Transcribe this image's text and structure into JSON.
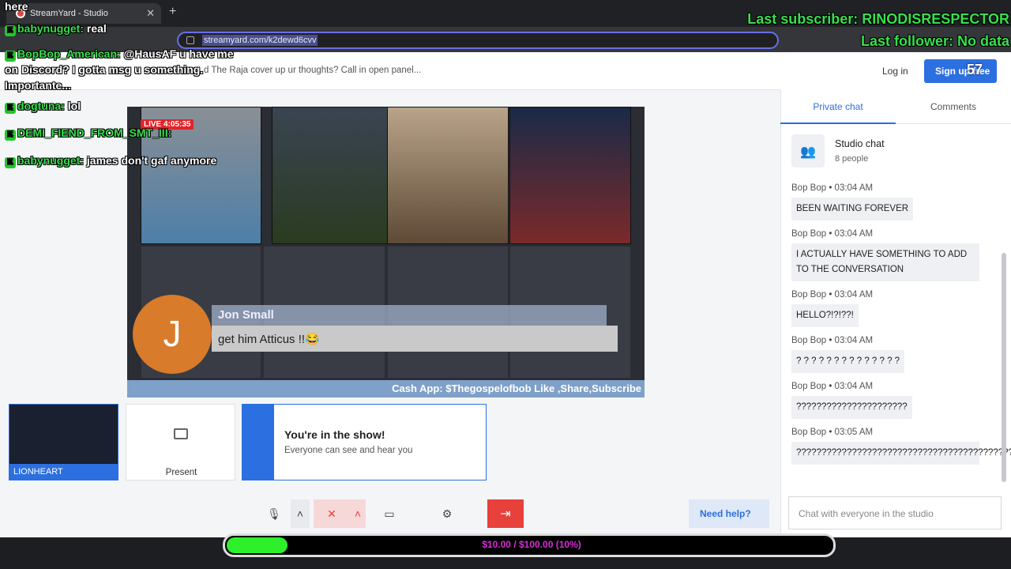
{
  "browser": {
    "tab_title": "StreamYard - Studio",
    "url": "streamyard.com/k2dewd6cvv"
  },
  "header": {
    "question": "d The Raja cover up ur thoughts? Call in open panel...",
    "login": "Log in",
    "signup": "Sign up free"
  },
  "stage": {
    "live_label": "LIVE 4:05:35",
    "banner_name": "Jon Small",
    "banner_message": "get him Atticus !!😂",
    "avatar_letter": "J",
    "ticker": "Cash App: $Thegospelofbob Like ,Share,Subscribe"
  },
  "self": {
    "name": "LIONHEART"
  },
  "present": {
    "label": "Present"
  },
  "inshow": {
    "title": "You're in the show!",
    "subtitle": "Everyone can see and hear you"
  },
  "controls": {
    "help": "Need help?"
  },
  "sidebar": {
    "tabs": [
      "Private chat",
      "Comments"
    ],
    "studio_title": "Studio chat",
    "studio_people": "8 people",
    "messages": [
      {
        "author": "Bop Bop",
        "time": "03:04 AM",
        "text": "BEEN WAITING FOREVER"
      },
      {
        "author": "Bop Bop",
        "time": "03:04 AM",
        "text": "I ACTUALLY HAVE SOMETHING TO ADD TO THE CONVERSATION"
      },
      {
        "author": "Bop Bop",
        "time": "03:04 AM",
        "text": "HELLO?!?!??!"
      },
      {
        "author": "Bop Bop",
        "time": "03:04 AM",
        "text": "? ? ? ? ? ? ? ? ? ? ? ? ? ?"
      },
      {
        "author": "Bop Bop",
        "time": "03:04 AM",
        "text": "??????????????????????"
      },
      {
        "author": "Bop Bop",
        "time": "03:05 AM",
        "text": "?????????????????????????????????????????????"
      }
    ],
    "chat_placeholder": "Chat with everyone in the studio"
  },
  "overlay": {
    "top_word": "here",
    "chat": [
      {
        "user": "babynugget:",
        "text": "real"
      },
      {
        "user": "BopBop_American:",
        "text": "@HausAF u have me on Discord? I gotta msg u something. Importante..."
      },
      {
        "user": "dogtuna:",
        "text": "lol"
      },
      {
        "user": "DEMI_FIEND_FROM_SMT_III:",
        "text": ""
      },
      {
        "user": "babynugget:",
        "text": "james don't gaf anymore"
      }
    ],
    "last_subscriber": "Last subscriber: RINODISRESPECTOR",
    "last_follower": "Last follower: No data",
    "viewer_count": "57",
    "goal_text": "$10.00 / $100.00 (10%)",
    "goal_fraction": 0.1
  }
}
